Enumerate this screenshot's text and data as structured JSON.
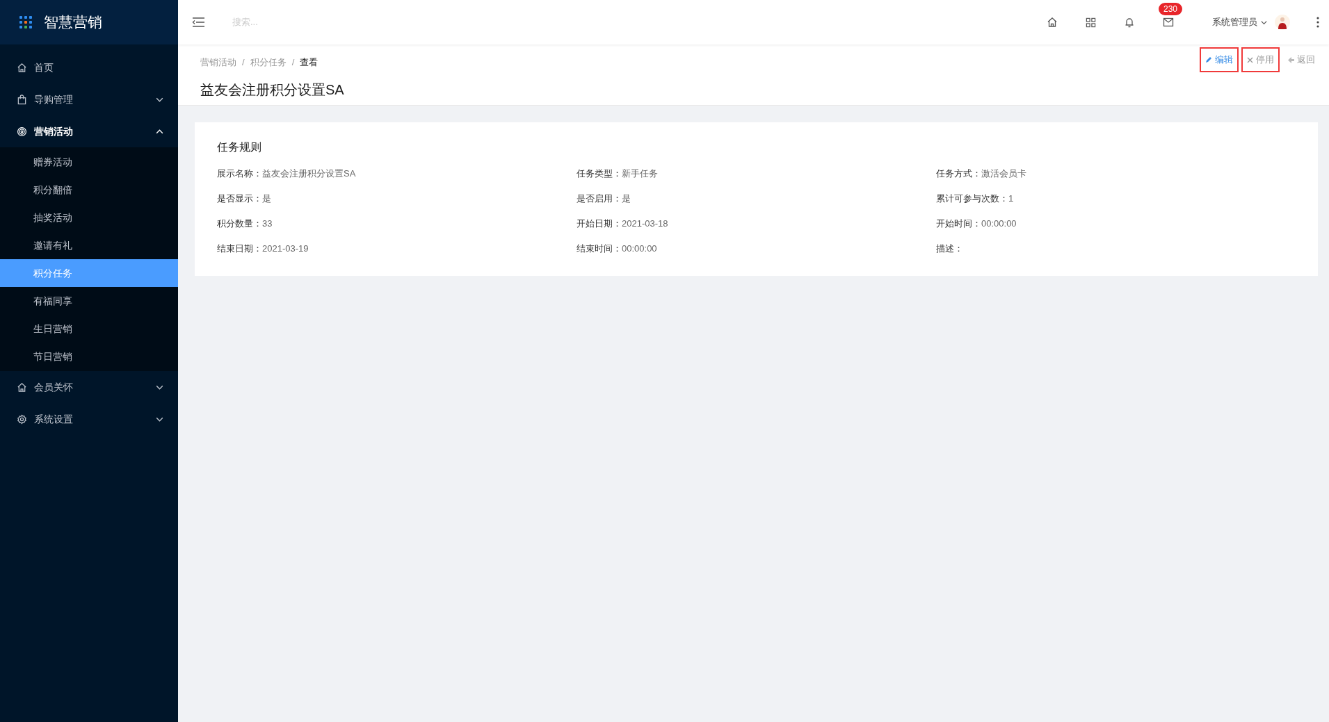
{
  "sidebar": {
    "logo": "智慧营销",
    "items": [
      {
        "label": "首页"
      },
      {
        "label": "导购管理",
        "expanded": false
      },
      {
        "label": "营销活动",
        "expanded": true,
        "children": [
          {
            "label": "赠券活动",
            "selected": false
          },
          {
            "label": "积分翻倍",
            "selected": false
          },
          {
            "label": "抽奖活动",
            "selected": false
          },
          {
            "label": "邀请有礼",
            "selected": false
          },
          {
            "label": "积分任务",
            "selected": true
          },
          {
            "label": "有福同享",
            "selected": false
          },
          {
            "label": "生日营销",
            "selected": false
          },
          {
            "label": "节日营销",
            "selected": false
          }
        ]
      },
      {
        "label": "会员关怀",
        "expanded": false
      },
      {
        "label": "系统设置",
        "expanded": false
      }
    ]
  },
  "topbar": {
    "search": {
      "placeholder": "搜索..."
    },
    "message_count": "230",
    "user": "系统管理员"
  },
  "breadcrumb": {
    "separator": "/",
    "items": [
      "营销活动",
      "积分任务",
      "查看"
    ]
  },
  "page_title": "益友会注册积分设置SA",
  "actions": [
    {
      "label": "编辑",
      "kind": "edit",
      "highlighted": true
    },
    {
      "label": "停用",
      "kind": "disable",
      "highlighted": true
    },
    {
      "label": "返回",
      "kind": "back",
      "highlighted": false
    }
  ],
  "card": {
    "title": "任务规则",
    "fields": [
      {
        "label": "展示名称：",
        "value": "益友会注册积分设置SA"
      },
      {
        "label": "任务类型：",
        "value": "新手任务"
      },
      {
        "label": "任务方式：",
        "value": "激活会员卡"
      },
      {
        "label": "是否显示：",
        "value": "是"
      },
      {
        "label": "是否启用：",
        "value": "是"
      },
      {
        "label": "累计可参与次数：",
        "value": "1"
      },
      {
        "label": "积分数量：",
        "value": "33"
      },
      {
        "label": "开始日期：",
        "value": "2021-03-18"
      },
      {
        "label": "开始时间：",
        "value": "00:00:00"
      },
      {
        "label": "结束日期：",
        "value": "2021-03-19"
      },
      {
        "label": "结束时间：",
        "value": "00:00:00"
      },
      {
        "label": "描述："
      }
    ]
  }
}
